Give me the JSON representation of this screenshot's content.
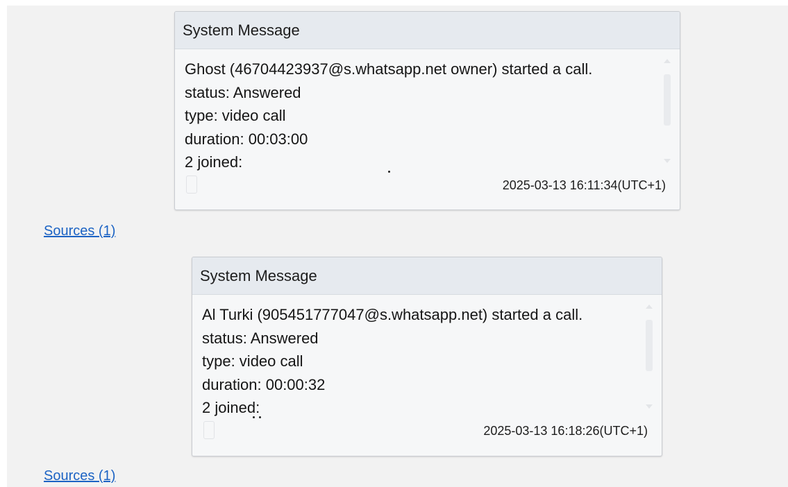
{
  "messages": [
    {
      "header": "System Message",
      "lines": [
        "Ghost (46704423937@s.whatsapp.net owner) started a call.",
        "status: Answered",
        "type: video call",
        "duration: 00:03:00",
        "2 joined:"
      ],
      "device_icon": "phone-outline-icon",
      "timestamp": "2025-03-13 16:11:34(UTC+1)",
      "sources_label": "Sources (1)"
    },
    {
      "header": "System Message",
      "lines": [
        "Al Turki (905451777047@s.whatsapp.net) started a call.",
        "status: Answered",
        "type: video call",
        "duration: 00:00:32",
        "2 joined:"
      ],
      "device_icon": "phone-outline-icon",
      "timestamp": "2025-03-13 16:18:26(UTC+1)",
      "sources_label": "Sources (1)"
    }
  ],
  "colors": {
    "link": "#1c63c4",
    "header_bg": "#e6eaef",
    "card_bg": "#f6f7f8",
    "panel_bg": "#f2f2f2"
  }
}
